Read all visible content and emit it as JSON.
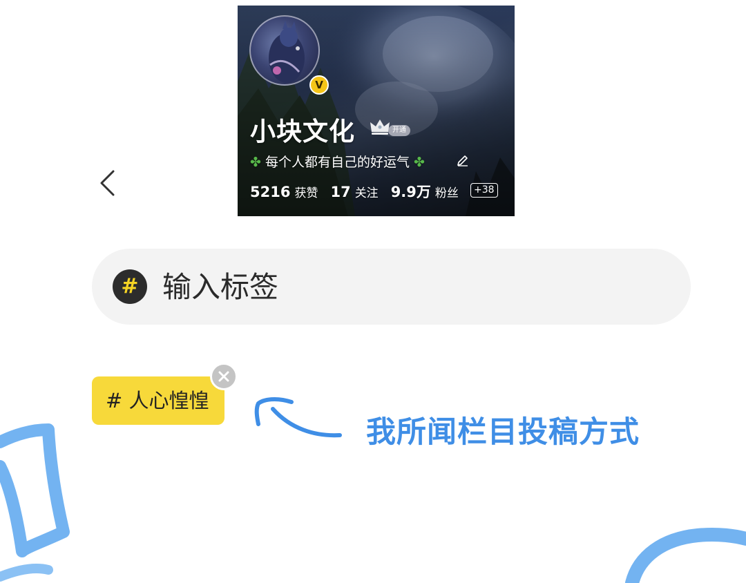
{
  "profile_card": {
    "avatar_badge": "V",
    "name": "小块文化",
    "open_badge": "开通",
    "bio": "每个人都有自己的好运气",
    "stats": [
      {
        "value": "5216",
        "label": "获赞"
      },
      {
        "value": "17",
        "label": "关注"
      },
      {
        "value": "9.9万",
        "label": "粉丝"
      }
    ],
    "stats_extra": "+38"
  },
  "tag_input": {
    "icon": "#",
    "placeholder": "输入标签"
  },
  "tag_chip": {
    "label": "# 人心惶惶"
  },
  "annotation": {
    "text": "我所闻栏目投稿方式"
  },
  "icons": {
    "back": "chevron-left-icon",
    "crown": "crown-icon",
    "edit": "pencil-icon",
    "close": "close-icon",
    "clover": "four-leaf-clover-icon"
  },
  "colors": {
    "accent_yellow": "#f7d93a",
    "annotation_blue": "#3f8ee6",
    "input_bg": "#f3f3f3",
    "hash_circle_bg": "#2c2c2c"
  }
}
